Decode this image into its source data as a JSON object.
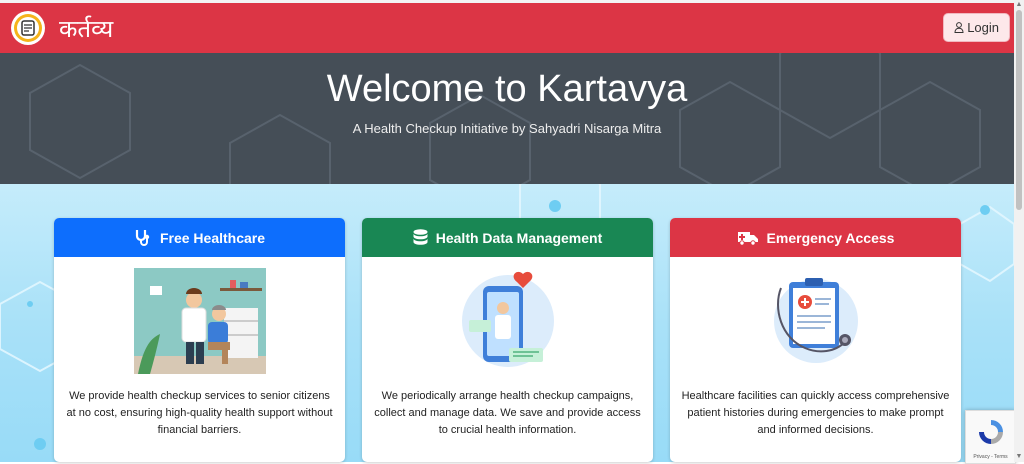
{
  "nav": {
    "brand": "कर्तव्य",
    "login_label": "Login"
  },
  "hero": {
    "title": "Welcome to Kartavya",
    "subtitle": "A Health Checkup Initiative by Sahyadri Nisarga Mitra"
  },
  "cards": [
    {
      "title": "Free Healthcare",
      "color": "#0d6efd",
      "icon": "stethoscope-icon",
      "text": "We provide health checkup services to senior citizens at no cost, ensuring high-quality health support without financial barriers."
    },
    {
      "title": "Health Data Management",
      "color": "#198754",
      "icon": "database-icon",
      "text": "We periodically arrange health checkup campaigns, collect and manage data. We save and provide access to crucial health information."
    },
    {
      "title": "Emergency Access",
      "color": "#dc3545",
      "icon": "ambulance-icon",
      "text": "Healthcare facilities can quickly access comprehensive patient histories during emergencies to make prompt and informed decisions."
    }
  ],
  "recaptcha": {
    "text": "Privacy - Terms"
  }
}
